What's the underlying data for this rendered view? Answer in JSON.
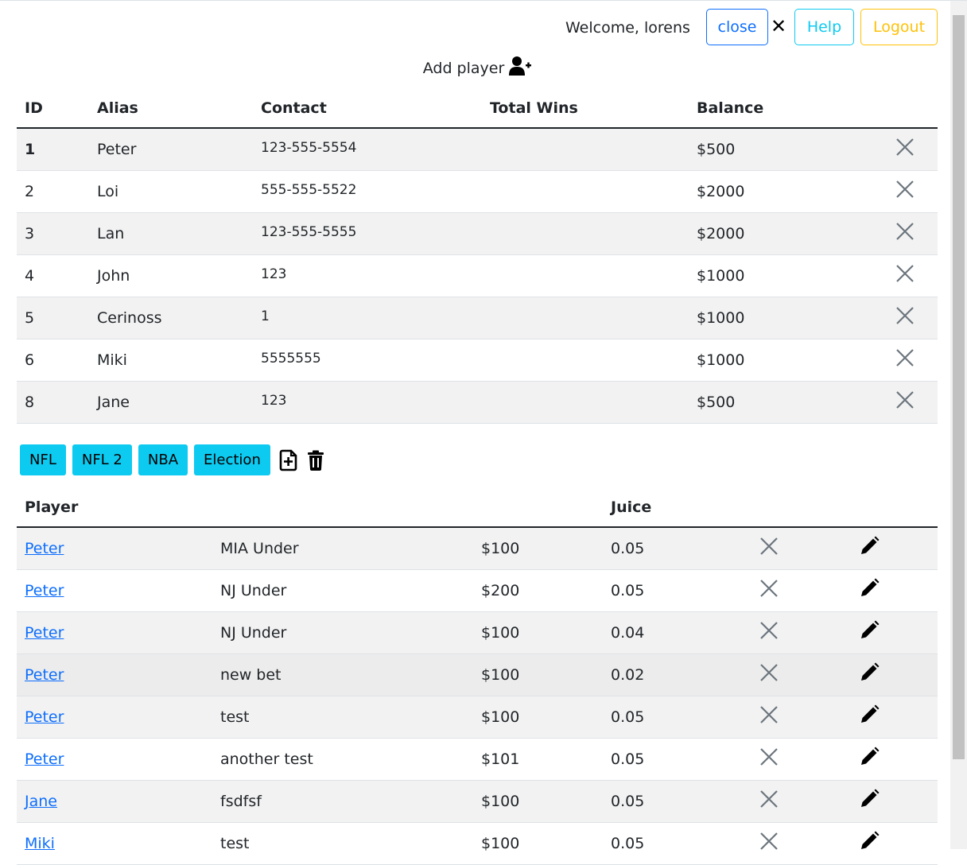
{
  "header": {
    "welcome": "Welcome, lorens",
    "close_label": "close",
    "close_x": "✕",
    "help_label": "Help",
    "logout_label": "Logout"
  },
  "add_player": {
    "label": "Add player",
    "icon": "user-plus-icon"
  },
  "players": {
    "columns": [
      "ID",
      "Alias",
      "Contact",
      "Total Wins",
      "Balance"
    ],
    "rows": [
      {
        "id": "1",
        "alias": "Peter",
        "contact": "123-555-5554",
        "wins": "",
        "balance": "$500"
      },
      {
        "id": "2",
        "alias": "Loi",
        "contact": "555-555-5522",
        "wins": "",
        "balance": "$2000"
      },
      {
        "id": "3",
        "alias": "Lan",
        "contact": "123-555-5555",
        "wins": "",
        "balance": "$2000"
      },
      {
        "id": "4",
        "alias": "John",
        "contact": "123",
        "wins": "",
        "balance": "$1000"
      },
      {
        "id": "5",
        "alias": "Cerinoss",
        "contact": "1",
        "wins": "",
        "balance": "$1000"
      },
      {
        "id": "6",
        "alias": "Miki",
        "contact": "5555555",
        "wins": "",
        "balance": "$1000"
      },
      {
        "id": "8",
        "alias": "Jane",
        "contact": "123",
        "wins": "",
        "balance": "$500"
      }
    ]
  },
  "tabs": [
    "NFL",
    "NFL 2",
    "NBA",
    "Election"
  ],
  "tab_icons": [
    "file-plus-icon",
    "trash-icon"
  ],
  "bets": {
    "columns": [
      "Player",
      "",
      "",
      "Juice",
      "",
      ""
    ],
    "rows": [
      {
        "player": "Peter",
        "bet": "MIA Under",
        "amount": "$100",
        "juice": "0.05"
      },
      {
        "player": "Peter",
        "bet": "NJ Under",
        "amount": "$200",
        "juice": "0.05"
      },
      {
        "player": "Peter",
        "bet": "NJ Under",
        "amount": "$100",
        "juice": "0.04"
      },
      {
        "player": "Peter",
        "bet": "new bet",
        "amount": "$100",
        "juice": "0.02"
      },
      {
        "player": "Peter",
        "bet": "test",
        "amount": "$100",
        "juice": "0.05"
      },
      {
        "player": "Peter",
        "bet": "another test",
        "amount": "$101",
        "juice": "0.05"
      },
      {
        "player": "Jane",
        "bet": "fsdfsf",
        "amount": "$100",
        "juice": "0.05"
      },
      {
        "player": "Miki",
        "bet": "test",
        "amount": "$100",
        "juice": "0.05"
      }
    ]
  },
  "colors": {
    "primary": "#0d6efd",
    "info": "#0dcaf0",
    "warning": "#ffc107",
    "stripe": "#f2f2f2"
  }
}
